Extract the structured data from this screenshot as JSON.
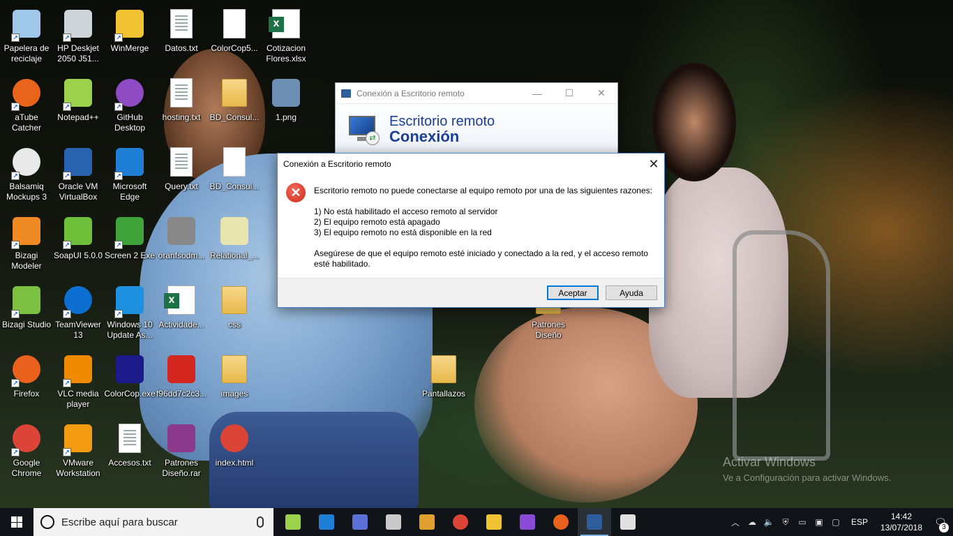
{
  "desktop": {
    "icons": [
      {
        "label": "Papelera de reciclaje",
        "icon": "recycle-bin-icon",
        "color": "#9fc7e8"
      },
      {
        "label": "HP Deskjet 2050 J51...",
        "icon": "printer-icon",
        "color": "#cfd4da"
      },
      {
        "label": "WinMerge",
        "icon": "winmerge-icon",
        "color": "#f1c232"
      },
      {
        "label": "Datos.txt",
        "icon": "text-file-icon"
      },
      {
        "label": "ColorCop5...",
        "icon": "blank-file-icon"
      },
      {
        "label": "Cotizacion Flores.xlsx",
        "icon": "excel-file-icon"
      },
      {
        "label": "aTube Catcher",
        "icon": "atube-catcher-icon",
        "color": "#e8641b"
      },
      {
        "label": "Notepad++",
        "icon": "notepadpp-icon",
        "color": "#9bd14b"
      },
      {
        "label": "GitHub Desktop",
        "icon": "github-icon",
        "color": "#8e4bc3"
      },
      {
        "label": "hosting.txt",
        "icon": "text-file-icon"
      },
      {
        "label": "BD_Consul...",
        "icon": "folder-icon"
      },
      {
        "label": "1.png",
        "icon": "image-file-icon",
        "color": "#6c8fb3"
      },
      {
        "label": "Balsamiq Mockups 3",
        "icon": "balsamiq-icon",
        "color": "#e9e9e9"
      },
      {
        "label": "Oracle VM VirtualBox",
        "icon": "virtualbox-icon",
        "color": "#2a64b0"
      },
      {
        "label": "Microsoft Edge",
        "icon": "edge-icon",
        "color": "#1f7fd6"
      },
      {
        "label": "Query.txt",
        "icon": "text-file-icon"
      },
      {
        "label": "BD_Consul...",
        "icon": "blank-file-icon"
      },
      {
        "label": "Bizagi Modeler",
        "icon": "bizagi-modeler-icon",
        "color": "#f08a24"
      },
      {
        "label": "SoapUI 5.0.0",
        "icon": "soapui-icon",
        "color": "#6fbf3a"
      },
      {
        "label": "Screen 2 Exe",
        "icon": "screen2exe-icon",
        "color": "#3fa33a"
      },
      {
        "label": "oranfsodm...",
        "icon": "gear-file-icon"
      },
      {
        "label": "Relational_...",
        "icon": "diagram-file-icon",
        "color": "#e8e4b0"
      },
      {
        "label": "Bizagi Studio",
        "icon": "bizagi-studio-icon",
        "color": "#7cc142"
      },
      {
        "label": "TeamViewer 13",
        "icon": "teamviewer-icon",
        "color": "#0e6fd3"
      },
      {
        "label": "Windows 10 Update As...",
        "icon": "windows-update-icon",
        "color": "#1e90e0"
      },
      {
        "label": "Actividade...",
        "icon": "excel-file-icon"
      },
      {
        "label": "css",
        "icon": "folder-icon"
      },
      {
        "label": "Patrones Diseño",
        "icon": "folder-icon"
      },
      {
        "label": "Firefox",
        "icon": "firefox-icon",
        "color": "#e8621e"
      },
      {
        "label": "VLC media player",
        "icon": "vlc-icon",
        "color": "#f08a00"
      },
      {
        "label": "ColorCop.exe",
        "icon": "colorcop-icon",
        "color": "#1a1a8a"
      },
      {
        "label": "f96dd7c2c3...",
        "icon": "pdf-file-icon",
        "color": "#d3261e"
      },
      {
        "label": "images",
        "icon": "folder-icon"
      },
      {
        "label": "Pantallazos",
        "icon": "folder-icon"
      },
      {
        "label": "Google Chrome",
        "icon": "chrome-icon",
        "color": "#db4437"
      },
      {
        "label": "VMware Workstation",
        "icon": "vmware-icon",
        "color": "#f39c12"
      },
      {
        "label": "Accesos.txt",
        "icon": "text-file-icon"
      },
      {
        "label": "Patrones Diseño.rar",
        "icon": "winrar-icon",
        "color": "#8b3a8b"
      },
      {
        "label": "index.html",
        "icon": "chrome-icon",
        "color": "#db4437"
      }
    ]
  },
  "remote_window": {
    "title": "Conexión a Escritorio remoto",
    "banner_line1": "Escritorio remoto",
    "banner_line2": "Conexión"
  },
  "dialog": {
    "title": "Conexión a Escritorio remoto",
    "message_intro": "Escritorio remoto no puede conectarse al equipo remoto por una de las siguientes razones:",
    "reasons": [
      "1) No está habilitado el acceso remoto al servidor",
      "2) El equipo remoto está apagado",
      "3) El equipo remoto no está disponible en la red"
    ],
    "message_outro": "Asegúrese de que el equipo remoto esté iniciado y conectado a la red, y el acceso remoto esté habilitado.",
    "ok_label": "Aceptar",
    "help_label": "Ayuda"
  },
  "watermark": {
    "title": "Activar Windows",
    "subtitle": "Ve a Configuración para activar Windows."
  },
  "taskbar": {
    "search_placeholder": "Escribe aquí para buscar",
    "apps": [
      {
        "name": "notepadpp",
        "color": "#9bd14b"
      },
      {
        "name": "edge",
        "color": "#1f7fd6"
      },
      {
        "name": "link-app",
        "color": "#5b6fd6"
      },
      {
        "name": "database-app",
        "color": "#c9c9c9"
      },
      {
        "name": "tools-app",
        "color": "#e0a030"
      },
      {
        "name": "chrome",
        "color": "#db4437"
      },
      {
        "name": "file-explorer",
        "color": "#f1c232"
      },
      {
        "name": "visual-studio",
        "color": "#8a4bd6"
      },
      {
        "name": "firefox",
        "color": "#e8621e"
      },
      {
        "name": "remote-desktop",
        "color": "#2f5d9b"
      },
      {
        "name": "paint",
        "color": "#e0e0e0"
      }
    ],
    "language": "ESP",
    "time": "14:42",
    "date": "13/07/2018",
    "notification_count": "3"
  }
}
